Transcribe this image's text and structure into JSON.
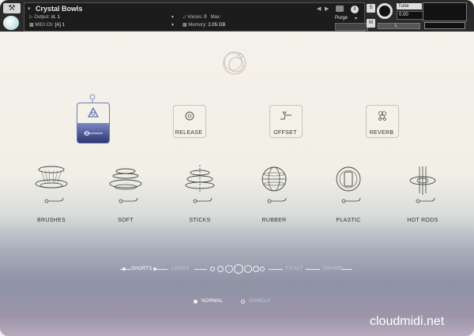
{
  "header": {
    "instrument_name": "Crystal Bowls",
    "output_label": "Output:",
    "output_value": "st. 1",
    "midi_label": "MIDI Ch:",
    "midi_value": "[A] 1",
    "voices_label": "Voices:",
    "voices_value": "0",
    "max_label": "Max:",
    "max_value": "",
    "memory_label": "Memory:",
    "memory_value": "2.05 GB",
    "purge_label": "Purge",
    "tune_label": "Tune",
    "tune_value": "0.00",
    "s_label": "S",
    "m_label": "M",
    "pan_label": "L",
    "info_label": "i"
  },
  "controls": [
    {
      "label": "RELEASE"
    },
    {
      "label": "OFFSET"
    },
    {
      "label": "REVERB"
    }
  ],
  "instruments": [
    {
      "label": "BRUSHES"
    },
    {
      "label": "SOFT"
    },
    {
      "label": "STICKS"
    },
    {
      "label": "RUBBER"
    },
    {
      "label": "PLASTIC"
    },
    {
      "label": "HOT RODS"
    }
  ],
  "articulations": {
    "items": [
      "SHORTS",
      "LONGS",
      "FX/ALT",
      "SWARM"
    ],
    "selected": "SHORTS"
  },
  "modes": {
    "items": [
      "NORMAL",
      "GAMELO"
    ],
    "selected": "NORMAL"
  },
  "watermark": "cloudmidi.net",
  "colors": {
    "accent": "#2d3670",
    "accent_light": "#7b88c4",
    "header_bg": "#2a2a2a"
  }
}
